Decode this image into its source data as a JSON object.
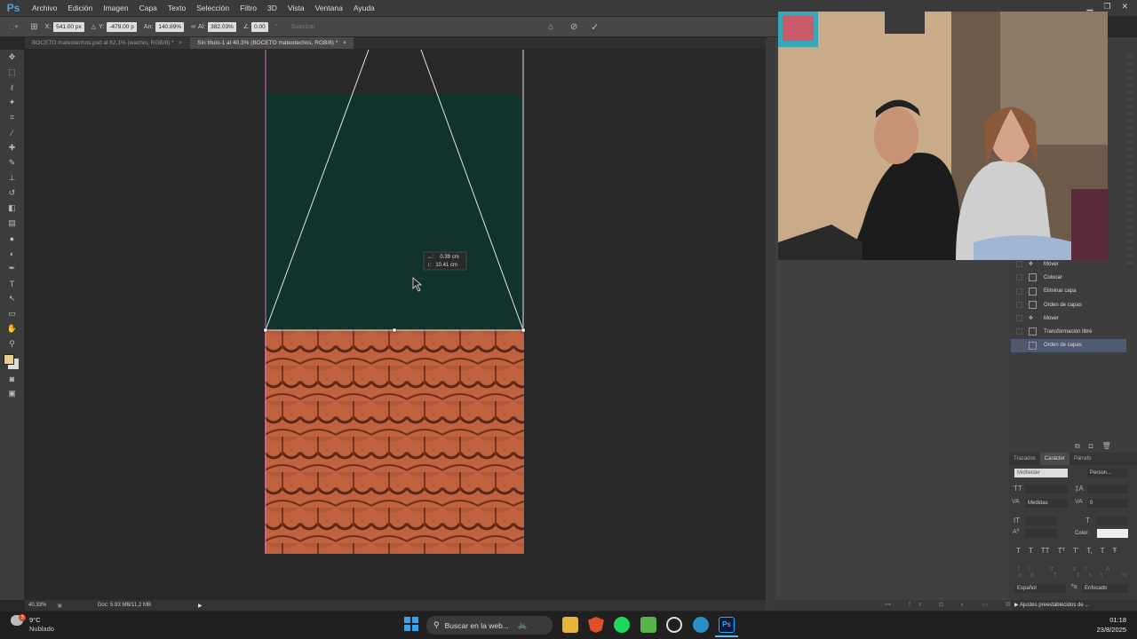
{
  "menubar": {
    "logo": "Ps",
    "items": [
      "Archivo",
      "Edición",
      "Imagen",
      "Capa",
      "Texto",
      "Selección",
      "Filtro",
      "3D",
      "Vista",
      "Ventana",
      "Ayuda"
    ]
  },
  "options": {
    "x_label": "X:",
    "x_value": "541.00 px",
    "y_label": "Y:",
    "y_value": "-479.00 p",
    "w_label": "An:",
    "w_value": "140.89%",
    "h_label": "Al:",
    "h_value": "382.03%",
    "angle_value": "0.00",
    "smooth_label": "Suavizar"
  },
  "tabs": [
    {
      "label": "BOCETO mateotechos.psd al 62.1% (wachin, RGB/8) *",
      "close": "×"
    },
    {
      "label": "Sin título-1 al 40.3% (BOCETO mateotechos, RGB/8) *",
      "close": "×"
    }
  ],
  "canvas": {
    "tooltip_line1": "0.39 cm",
    "tooltip_line2": "10.41 cm",
    "tooltip_sym1": "↔:",
    "tooltip_sym2": "↕:"
  },
  "status": {
    "zoom": "40.33%",
    "doc": "Doc: 5.93 MB/11.2 MB"
  },
  "history": {
    "items": [
      {
        "label": "Mover",
        "icon": "move-icon"
      },
      {
        "label": "Colocar",
        "icon": "document-icon"
      },
      {
        "label": "Eliminar capa",
        "icon": "document-icon"
      },
      {
        "label": "Orden de capas",
        "icon": "document-icon"
      },
      {
        "label": "Mover",
        "icon": "move-icon"
      },
      {
        "label": "Transformación libre",
        "icon": "document-icon"
      },
      {
        "label": "Orden de capas",
        "icon": "document-icon",
        "selected": true
      }
    ]
  },
  "char_panel": {
    "tabs": [
      "Trazados",
      "Carácter",
      "Párrafo"
    ],
    "font": "Midfielder",
    "style": "Person...",
    "kerning": "Medidas",
    "tracking": "0",
    "color_label": "Color:",
    "language": "Español",
    "antialias": "Enfocado",
    "glyph_row": [
      "T",
      "T",
      "TT",
      "Tᵀ",
      "T'",
      "T,",
      "T",
      "Ŧ"
    ]
  },
  "presets_label": "Ajustes preestablecidos de ...",
  "taskbar": {
    "weather_temp": "9°C",
    "weather_desc": "Nublado",
    "weather_badge": "3",
    "search_placeholder": "Buscar en la web...",
    "time": "01:18",
    "date": "23/8/2025"
  },
  "colors": {
    "fg_swatch": "#e8d08a",
    "canvas_green": "#12322c",
    "accent_selection": "#4f5a72"
  }
}
